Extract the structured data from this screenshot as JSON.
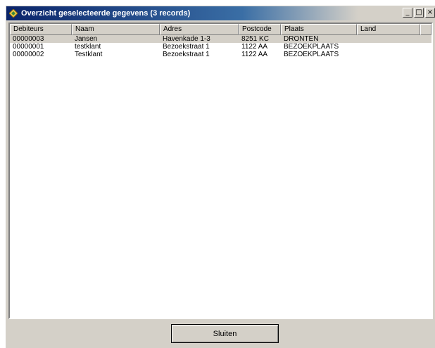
{
  "window": {
    "title": "Overzicht geselecteerde gegevens (3 records)",
    "icon": "app-icon",
    "minimize_glyph": "_",
    "maximize_glyph": "□",
    "close_glyph": "×"
  },
  "list": {
    "columns": [
      "Debiteurs",
      "Naam",
      "Adres",
      "Postcode",
      "Plaats",
      "Land"
    ],
    "rows": [
      {
        "debiteur": "00000003",
        "naam": "Jansen",
        "adres": "Havenkade 1-3",
        "postcode": "8251 KC",
        "plaats": "DRONTEN",
        "land": "",
        "selected": true
      },
      {
        "debiteur": "00000001",
        "naam": "testklant",
        "adres": "Bezoekstraat 1",
        "postcode": "1122 AA",
        "plaats": "BEZOEKPLAATS",
        "land": "",
        "selected": false
      },
      {
        "debiteur": "00000002",
        "naam": "Testklant",
        "adres": "Bezoekstraat 1",
        "postcode": "1122 AA",
        "plaats": "BEZOEKPLAATS",
        "land": "",
        "selected": false
      }
    ]
  },
  "footer": {
    "close_button_label": "Sluiten"
  },
  "colors": {
    "title_active": "#0a246a",
    "title_gradient_end": "#3a6ea5",
    "face": "#d4d0c8",
    "list_background": "#ffffff"
  }
}
